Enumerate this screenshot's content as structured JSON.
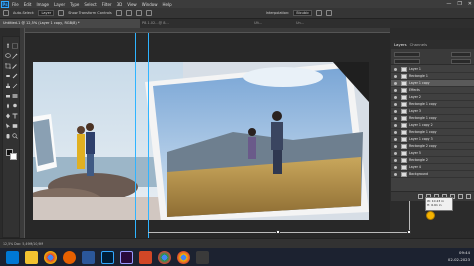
{
  "app": {
    "logo_text": "Ps"
  },
  "menu": {
    "items": [
      "File",
      "Edit",
      "Image",
      "Layer",
      "Type",
      "Select",
      "Filter",
      "3D",
      "View",
      "Window",
      "Help"
    ]
  },
  "window_controls": [
    "—",
    "❐",
    "✕"
  ],
  "options_bar": {
    "auto_select_label": "Auto-Select:",
    "auto_select_value": "Layer",
    "transform_label": "Show Transform Controls",
    "interpolation_label": "Interpolation:",
    "interpolation_value": "Bicubic"
  },
  "tabs": {
    "active": "Untitled-1 @ 12,5% (Layer 1 copy, RGB/8) *",
    "others": [
      "P8.1.02...@ 8...",
      "Ult...",
      "Un..."
    ]
  },
  "panels": {
    "tabs": [
      "Layers",
      "Channels"
    ]
  },
  "layers": [
    {
      "name": "Layer 1",
      "selected": false
    },
    {
      "name": "Rectangle 1",
      "selected": false
    },
    {
      "name": "Layer 1 copy",
      "selected": true
    },
    {
      "name": "Effects",
      "selected": false
    },
    {
      "name": "Layer 2",
      "selected": false
    },
    {
      "name": "Rectangle 1 copy",
      "selected": false
    },
    {
      "name": "Layer 3",
      "selected": false
    },
    {
      "name": "Rectangle 1 copy",
      "selected": false
    },
    {
      "name": "Layer 1 copy 2",
      "selected": false
    },
    {
      "name": "Rectangle 1 copy",
      "selected": false
    },
    {
      "name": "Layer 1 copy 3",
      "selected": false
    },
    {
      "name": "Rectangle 2 copy",
      "selected": false
    },
    {
      "name": "Layer 5",
      "selected": false
    },
    {
      "name": "Rectangle 2",
      "selected": false
    },
    {
      "name": "Layer 4",
      "selected": false
    },
    {
      "name": "Background",
      "selected": false
    }
  ],
  "tooltip": {
    "w": "W: 10.23 in",
    "h": "H: 6.61 in"
  },
  "status": {
    "text": "12,5%      Doc: 5,49M/10,9M"
  },
  "taskbar": {
    "apps": [
      "windows",
      "file-explorer",
      "chrome",
      "firefox",
      "word",
      "photoshop",
      "premiere",
      "powerpoint",
      "chrome-2",
      "chrome-3",
      "media"
    ],
    "time": "09:44",
    "date": "02-02-2023"
  },
  "colors": {
    "accent": "#31a8ff",
    "selection": "#5a5a5a"
  }
}
